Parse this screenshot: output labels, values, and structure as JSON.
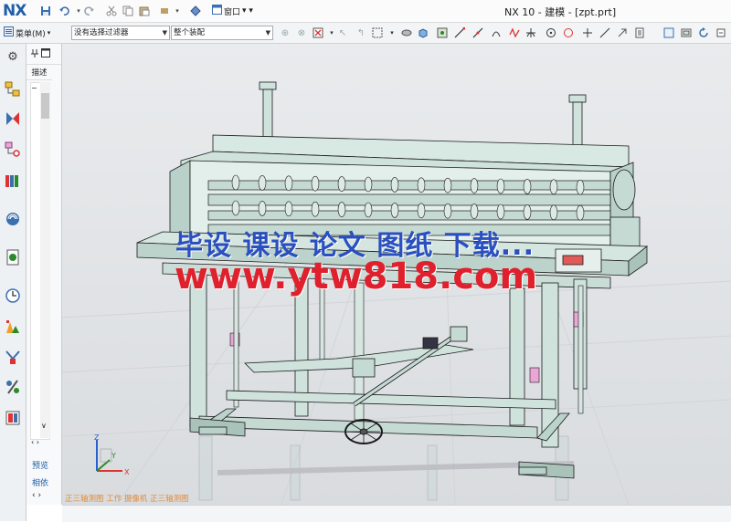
{
  "app": {
    "logo": "NX",
    "title": "NX 10 - 建模 - [zpt.prt]",
    "window_menu": "窗口"
  },
  "quick_access": [
    "save-icon",
    "undo-icon",
    "redo-icon",
    "cut-icon",
    "copy-icon",
    "paste-icon",
    "repeat-command-icon",
    "touch-mode-icon"
  ],
  "toolbar": {
    "menu_label": "菜单(M)",
    "selection_filter": "没有选择过滤器",
    "assembly_scope": "整个装配"
  },
  "navigator": {
    "tab_label": "描述",
    "collapse": "−",
    "arrow_down": "∨",
    "arrow_left_right": "‹ ›",
    "preview": "预览",
    "dependency": "相依",
    "h_scroll": "‹ ›"
  },
  "viewport": {
    "watermark_line1": "毕设 课设 论文 图纸 下载...",
    "watermark_line2": "www.ytw818.com",
    "status_text": "正三轴测图 工作 摄像机 正三轴测图",
    "triad_labels": {
      "x": "X",
      "y": "Y",
      "z": "Z"
    }
  },
  "colors": {
    "nx_blue": "#1f5fa8",
    "model_fill": "#cfe3dc",
    "model_edge": "#1a1a1a",
    "watermark_blue": "#2a4fbf",
    "watermark_red": "#e0202c",
    "status_orange": "#e08a3c",
    "pink_part": "#e9a6d6"
  }
}
